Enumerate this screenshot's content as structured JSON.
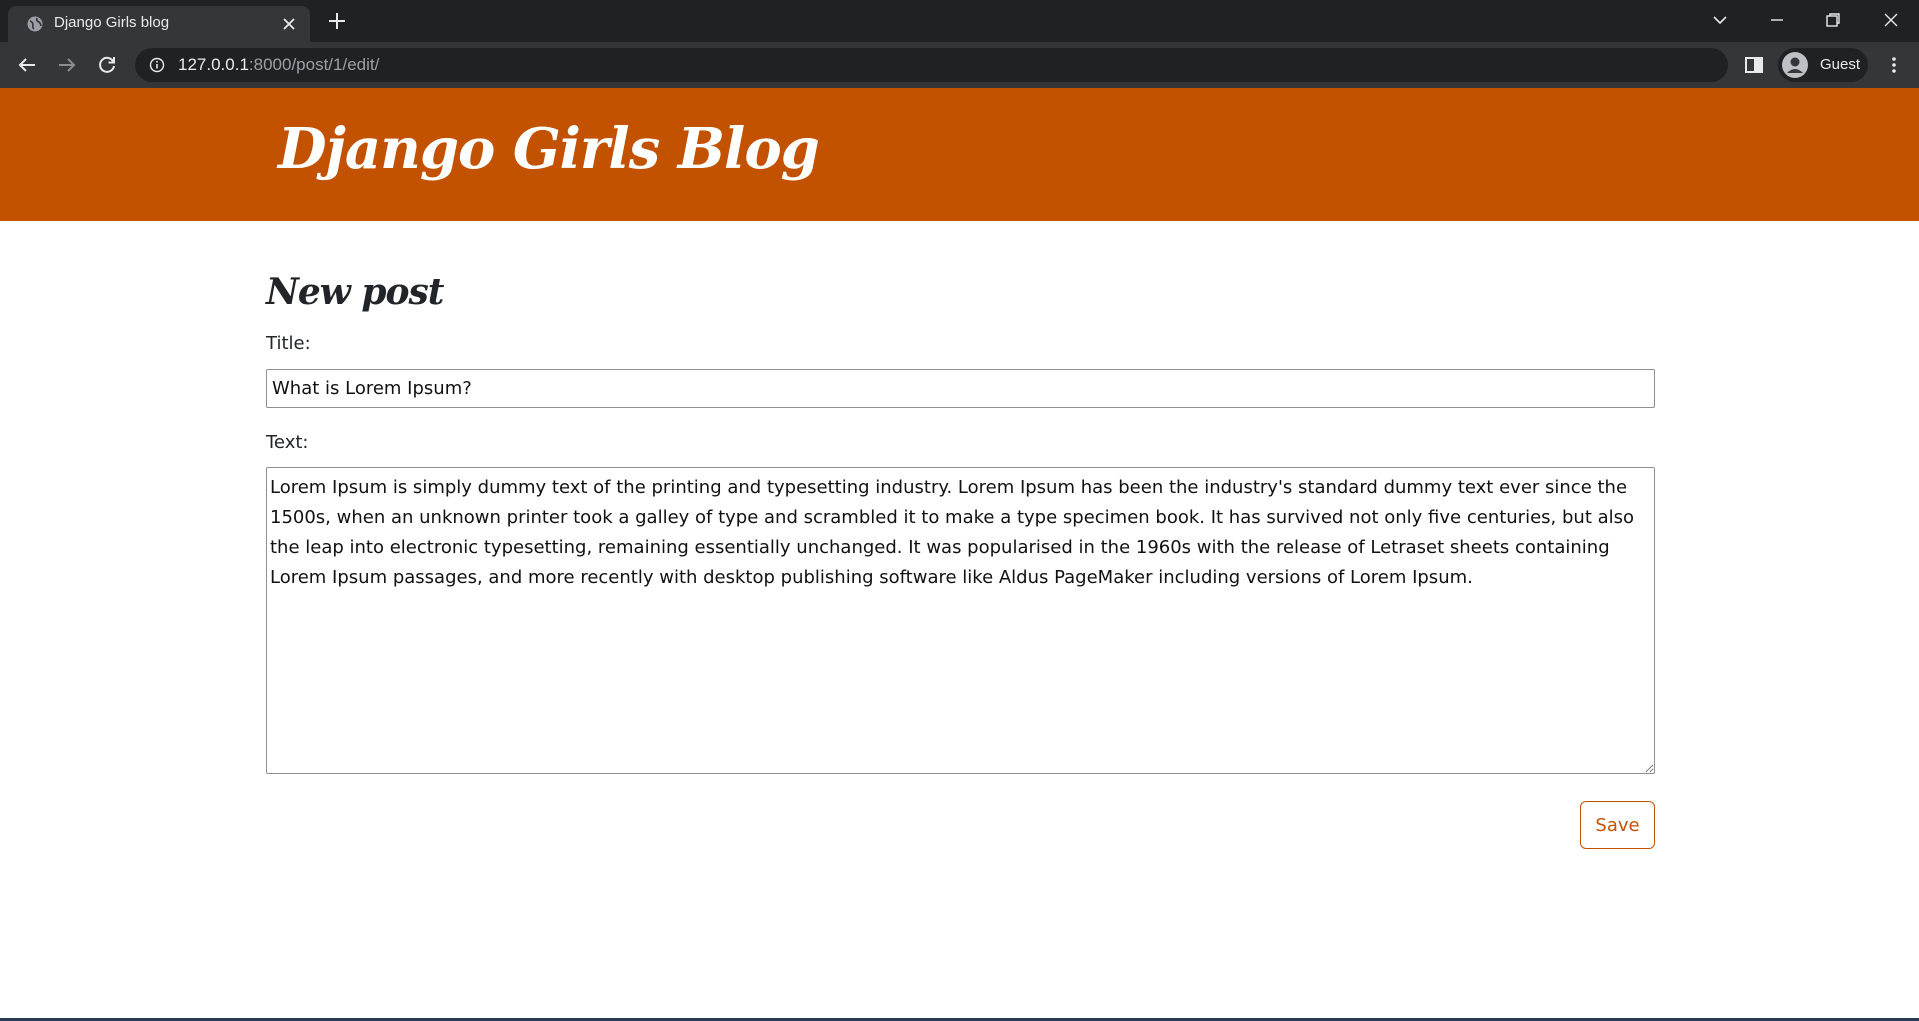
{
  "browser": {
    "tab_title": "Django Girls blog",
    "url_host": "127.0.0.1",
    "url_path": ":8000/post/1/edit/",
    "profile_label": "Guest",
    "icons": {
      "favicon": "globe-icon",
      "tab_close": "close-icon",
      "new_tab": "plus-icon",
      "tab_search": "chevron-down-icon",
      "minimize": "minimize-icon",
      "restore": "restore-icon",
      "close_window": "close-icon",
      "back": "back-arrow-icon",
      "forward": "forward-arrow-icon",
      "reload": "reload-icon",
      "site_info": "info-icon",
      "side_panel": "side-panel-icon",
      "avatar": "person-icon",
      "menu": "kebab-menu-icon"
    }
  },
  "header": {
    "site_title": "Django Girls Blog",
    "background_color": "#c25100"
  },
  "form": {
    "heading": "New post",
    "title_label": "Title:",
    "title_value": "What is Lorem Ipsum?",
    "text_label": "Text:",
    "text_value": "Lorem Ipsum is simply dummy text of the printing and typesetting industry. Lorem Ipsum has been the industry's standard dummy text ever since the 1500s, when an unknown printer took a galley of type and scrambled it to make a type specimen book. It has survived not only five centuries, but also the leap into electronic typesetting, remaining essentially unchanged. It was popularised in the 1960s with the release of Letraset sheets containing Lorem Ipsum passages, and more recently with desktop publishing software like Aldus PageMaker including versions of Lorem Ipsum.",
    "save_label": "Save",
    "accent_color": "#c25100"
  }
}
